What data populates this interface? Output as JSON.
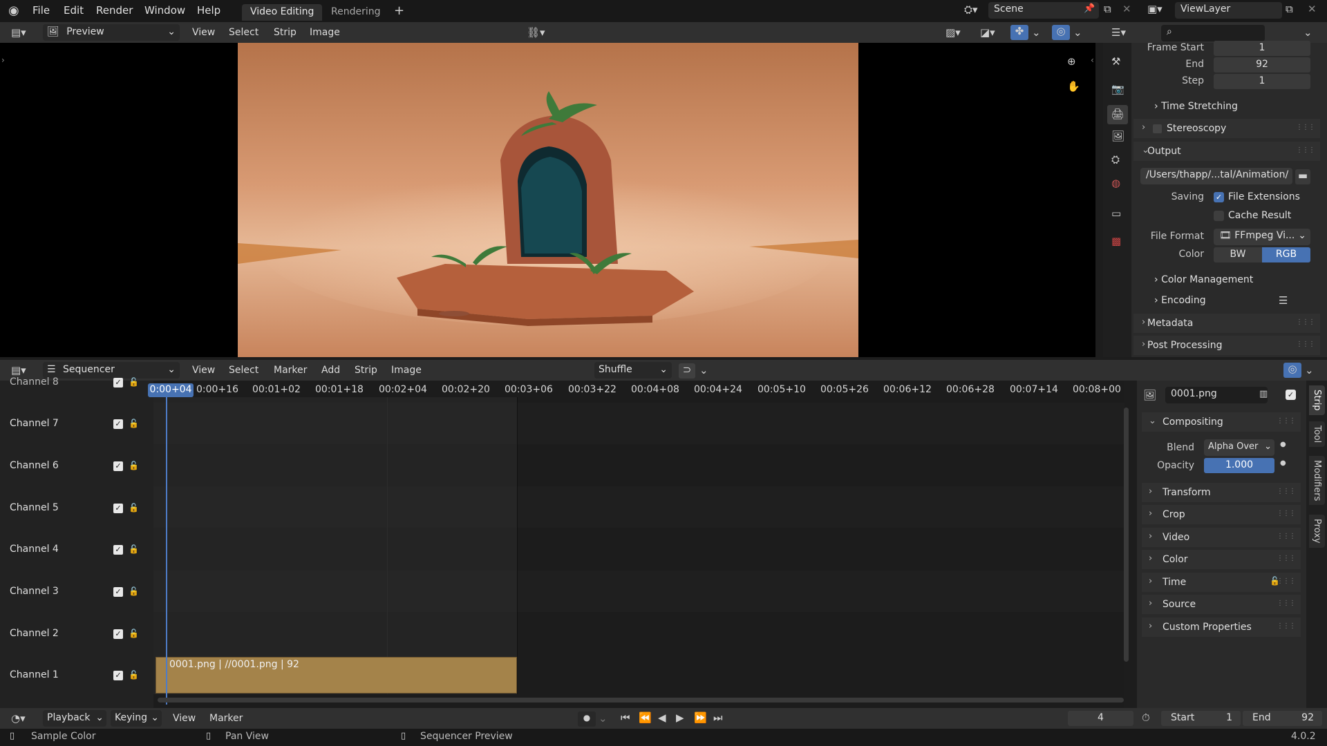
{
  "topbar": {
    "menus": [
      "File",
      "Edit",
      "Render",
      "Window",
      "Help"
    ],
    "workspaces": [
      "Video Editing",
      "Rendering"
    ],
    "scene": "Scene",
    "view_layer": "ViewLayer"
  },
  "preview": {
    "editor_mode": "Preview",
    "menus": [
      "View",
      "Select",
      "Strip",
      "Image"
    ]
  },
  "properties": {
    "frame_start_label": "Frame Start",
    "frame_start": "1",
    "end_label": "End",
    "end": "92",
    "step_label": "Step",
    "step": "1",
    "time_stretching": "Time Stretching",
    "stereoscopy": "Stereoscopy",
    "output": "Output",
    "output_path": "/Users/thapp/...tal/Animation/",
    "saving_label": "Saving",
    "file_extensions": "File Extensions",
    "cache_result": "Cache Result",
    "file_format_label": "File Format",
    "file_format": "FFmpeg Vi...",
    "color_label": "Color",
    "color_bw": "BW",
    "color_rgb": "RGB",
    "color_management": "Color Management",
    "encoding": "Encoding",
    "metadata": "Metadata",
    "post_processing": "Post Processing"
  },
  "sequencer": {
    "editor_mode": "Sequencer",
    "menus": [
      "View",
      "Select",
      "Marker",
      "Add",
      "Strip",
      "Image"
    ],
    "overlap_mode": "Shuffle",
    "channels": [
      "Channel 8",
      "Channel 7",
      "Channel 6",
      "Channel 5",
      "Channel 4",
      "Channel 3",
      "Channel 2",
      "Channel 1"
    ],
    "current_time": "0:00+04",
    "ticks": [
      "0:00+16",
      "00:01+02",
      "00:01+18",
      "00:02+04",
      "00:02+20",
      "00:03+06",
      "00:03+22",
      "00:04+08",
      "00:04+24",
      "00:05+10",
      "00:05+26",
      "00:06+12",
      "00:06+28",
      "00:07+14",
      "00:08+00"
    ],
    "strip_label": "0001.png | //0001.png | 92"
  },
  "strip_panel": {
    "strip_name": "0001.png",
    "compositing": "Compositing",
    "blend_label": "Blend",
    "blend": "Alpha Over",
    "opacity_label": "Opacity",
    "opacity": "1.000",
    "sections": [
      "Transform",
      "Crop",
      "Video",
      "Color",
      "Time",
      "Source",
      "Custom Properties"
    ],
    "tabs": [
      "Strip",
      "Tool",
      "Modifiers",
      "Proxy"
    ]
  },
  "timeline": {
    "menus": [
      "Playback",
      "Keying",
      "View",
      "Marker"
    ],
    "current_frame": "4",
    "start_label": "Start",
    "start": "1",
    "end_label": "End",
    "end": "92"
  },
  "status": {
    "items": [
      "Sample Color",
      "Pan View",
      "Sequencer Preview"
    ],
    "version": "4.0.2"
  }
}
